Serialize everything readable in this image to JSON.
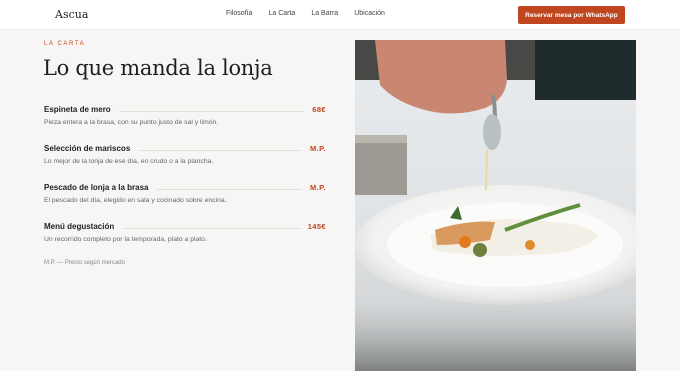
{
  "nav": {
    "brand": "Ascua",
    "links": [
      "Filosofía",
      "La Carta",
      "La Barra",
      "Ubicación"
    ],
    "cta": "Reservar mesa por WhatsApp"
  },
  "section": {
    "eyebrow": "LA CARTA",
    "title": "Lo que manda la lonja"
  },
  "menu": [
    {
      "name": "Espineta de mero",
      "price": "68€",
      "desc": "Pieza entera a la brasa, con su punto justo de sal y limón."
    },
    {
      "name": "Selección de mariscos",
      "price": "M.P.",
      "desc": "Lo mejor de la lonja de ese día, en crudo o a la plancha."
    },
    {
      "name": "Pescado de lonja a la brasa",
      "price": "M.P.",
      "desc": "El pescado del día, elegido en sala y cocinado sobre encina."
    },
    {
      "name": "Menú degustación",
      "price": "145€",
      "desc": "Un recorrido completo por la temporada, plato a plato."
    }
  ],
  "footnote": "M.P. — Precio según mercado",
  "colors": {
    "accent": "#c0461f",
    "background": "#f7f6f4"
  }
}
